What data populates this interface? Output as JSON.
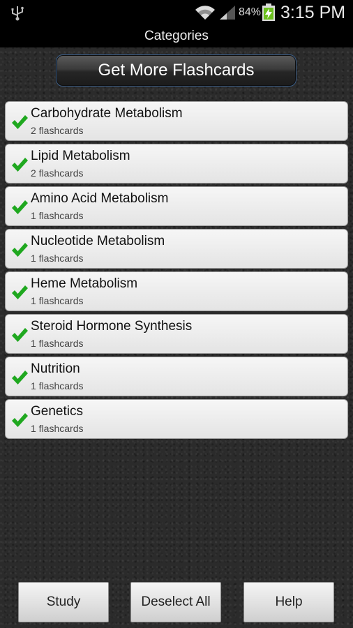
{
  "status_bar": {
    "battery_percent": "84%",
    "time": "3:15 PM",
    "icons": [
      "usb-icon",
      "wifi-icon",
      "signal-icon",
      "battery-charging-icon"
    ]
  },
  "title": "Categories",
  "get_more_label": "Get More Flashcards",
  "categories": [
    {
      "name": "Carbohydrate Metabolism",
      "count": "2 flashcards",
      "checked": true
    },
    {
      "name": "Lipid Metabolism",
      "count": "2 flashcards",
      "checked": true
    },
    {
      "name": "Amino Acid Metabolism",
      "count": "1 flashcards",
      "checked": true
    },
    {
      "name": "Nucleotide Metabolism",
      "count": "1 flashcards",
      "checked": true
    },
    {
      "name": "Heme Metabolism",
      "count": "1 flashcards",
      "checked": true
    },
    {
      "name": "Steroid Hormone Synthesis",
      "count": "1 flashcards",
      "checked": true
    },
    {
      "name": "Nutrition",
      "count": "1 flashcards",
      "checked": true
    },
    {
      "name": "Genetics",
      "count": "1 flashcards",
      "checked": true
    }
  ],
  "buttons": {
    "study": "Study",
    "deselect_all": "Deselect All",
    "help": "Help"
  },
  "colors": {
    "check": "#1fa81f",
    "accent_border": "#3b5d86"
  }
}
